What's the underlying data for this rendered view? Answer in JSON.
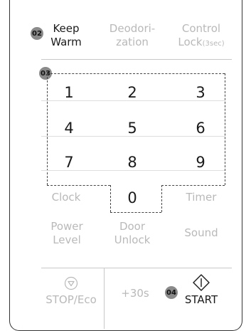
{
  "top_row": {
    "keep_warm": {
      "badge": "02",
      "line1": "Keep",
      "line2": "Warm"
    },
    "deodorization": {
      "line1": "Deodori-",
      "line2": "zation"
    },
    "control_lock": {
      "line1": "Control",
      "line2": "Lock",
      "suffix": "(3sec)"
    }
  },
  "keypad": {
    "badge": "03",
    "keys": [
      "1",
      "2",
      "3",
      "4",
      "5",
      "6",
      "7",
      "8",
      "9",
      "0"
    ]
  },
  "side_row": {
    "clock": "Clock",
    "timer": "Timer"
  },
  "third_row": {
    "power_level": {
      "line1": "Power",
      "line2": "Level"
    },
    "door_unlock": {
      "line1": "Door",
      "line2": "Unlock"
    },
    "sound": "Sound"
  },
  "bottom_row": {
    "stop": "STOP/Eco",
    "plus30": "+30s",
    "start": {
      "badge": "04",
      "label": "START"
    }
  }
}
